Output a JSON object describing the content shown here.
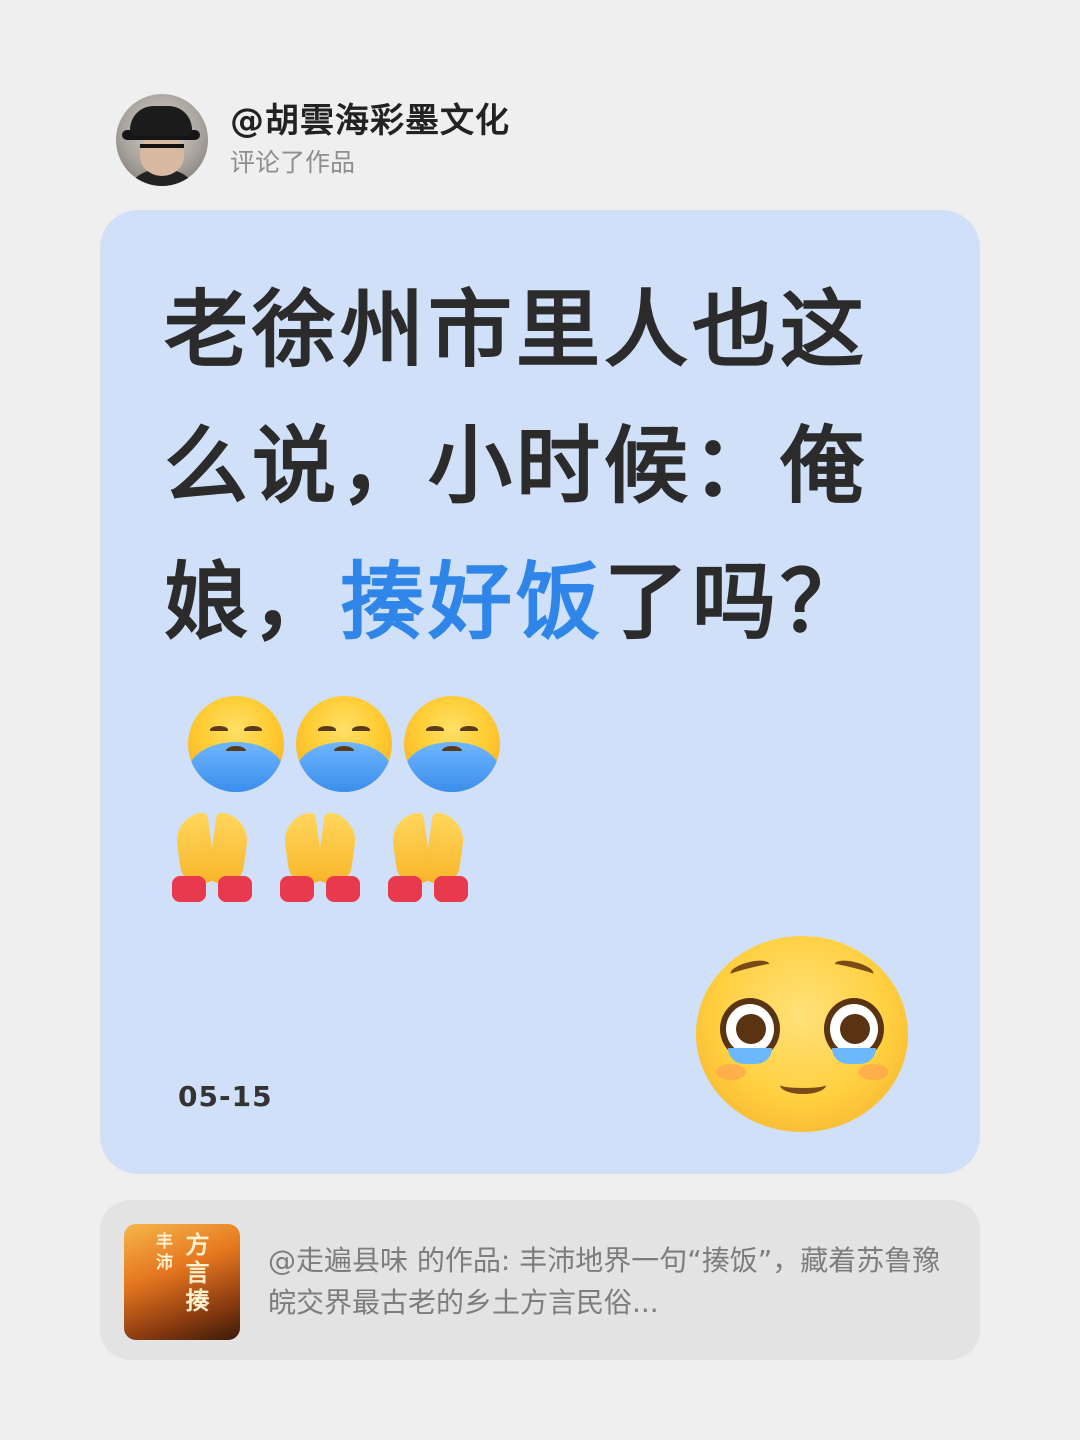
{
  "header": {
    "username": "@胡雲海彩墨文化",
    "action": "评论了作品"
  },
  "comment": {
    "text_before": "老徐州市里人也这么说，小时候：俺娘，",
    "highlight": "揍好饭",
    "text_after": "了吗？",
    "emojis_trailing": [
      "loudly-crying-face",
      "loudly-crying-face",
      "loudly-crying-face"
    ],
    "emojis_second_line": [
      "folded-hands",
      "folded-hands",
      "folded-hands"
    ],
    "sticker": "pleading-face",
    "date": "05-15",
    "highlight_color": "#2f86e8"
  },
  "quoted_work": {
    "thumbnail_text_small": "丰沛",
    "thumbnail_text_large": "方言揍",
    "text": "@走遍县味 的作品: 丰沛地界一句“揍饭”，藏着苏鲁豫皖交界最古老的乡土方言民俗..."
  },
  "colors": {
    "background": "#efefef",
    "card": "#cfe0f8",
    "quote_card": "#e3e3e3"
  }
}
